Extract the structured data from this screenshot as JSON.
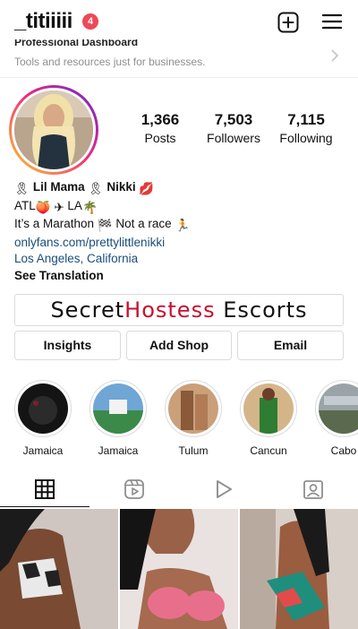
{
  "header": {
    "username": "_titiiiii",
    "notification_count": "4",
    "icons": [
      "plus-square-icon",
      "hamburger-menu-icon"
    ]
  },
  "dashboard": {
    "title": "Professional Dashboard",
    "subtitle": "Tools and resources just for businesses."
  },
  "stats": {
    "posts": {
      "value": "1,366",
      "label": "Posts"
    },
    "followers": {
      "value": "7,503",
      "label": "Followers"
    },
    "following": {
      "value": "7,115",
      "label": "Following"
    }
  },
  "bio": {
    "name_line": "Lil Mama",
    "name_line_2": "Nikki",
    "location_line_a": "ATL",
    "location_line_b": "LA",
    "tagline_a": "It’s a Marathon",
    "tagline_b": "Not a race",
    "link": "onlyfans.com/prettylittlenikki",
    "location": "Los Angeles, California",
    "see_translation": "See Translation"
  },
  "contact_banner": {
    "part1": "Secret",
    "part2": "Hostess",
    "part3": " Escorts"
  },
  "buttons": {
    "insights": "Insights",
    "add_shop": "Add Shop",
    "email": "Email"
  },
  "highlights": [
    {
      "label": "Jamaica"
    },
    {
      "label": "Jamaica"
    },
    {
      "label": "Tulum"
    },
    {
      "label": "Cancun"
    },
    {
      "label": "Cabo"
    }
  ],
  "tabs": [
    "grid-icon",
    "reels-icon",
    "video-play-icon",
    "tagged-icon"
  ],
  "colors": {
    "badge": "#ed4956",
    "link": "#1a4d7c",
    "banner_accent": "#c8102e",
    "story_ring_start": "#f9ce34",
    "story_ring_end": "#6228d7"
  }
}
